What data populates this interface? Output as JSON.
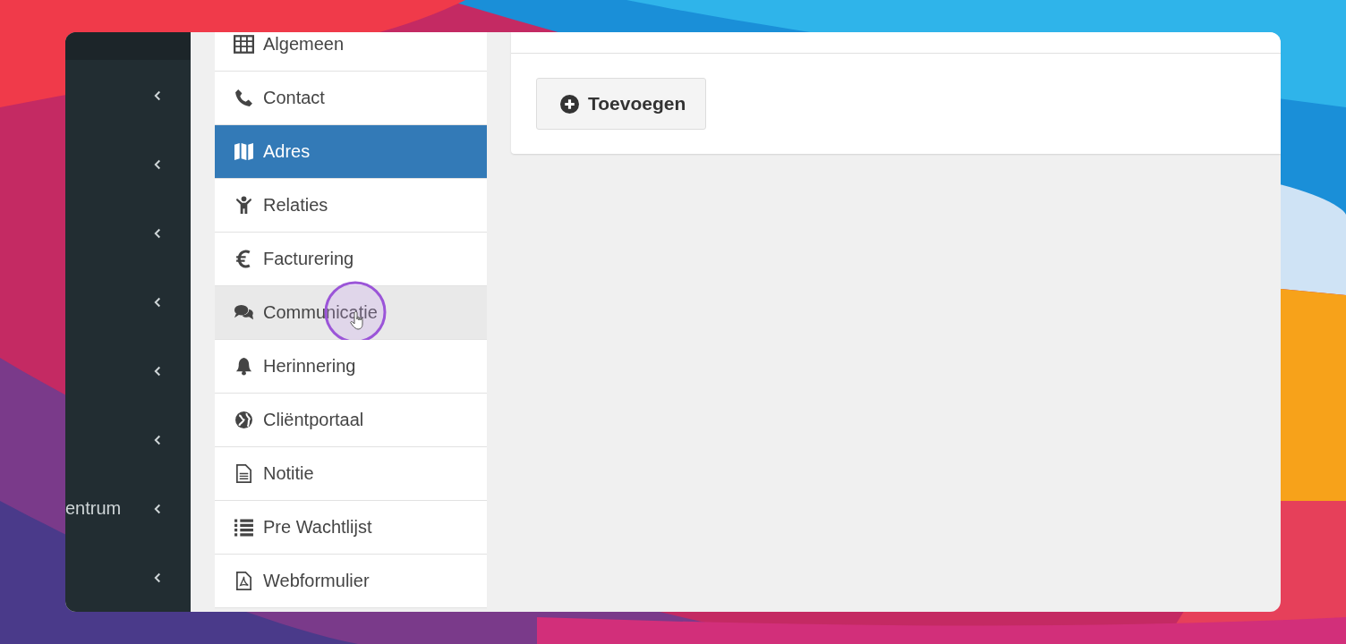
{
  "sidebar": {
    "items": [
      {
        "expanded": false
      },
      {
        "expanded": false
      },
      {
        "expanded": false
      },
      {
        "expanded": false
      },
      {
        "expanded": false
      },
      {
        "expanded": false
      },
      {
        "label": "entrum",
        "expanded": false
      },
      {
        "expanded": false
      }
    ]
  },
  "menu": {
    "items": [
      {
        "label": "Algemeen",
        "selected": false,
        "hovered": false,
        "pointer": false
      },
      {
        "label": "Contact",
        "selected": false,
        "hovered": false,
        "pointer": false
      },
      {
        "label": "Adres",
        "selected": true,
        "hovered": false,
        "pointer": false
      },
      {
        "label": "Relaties",
        "selected": false,
        "hovered": false,
        "pointer": false
      },
      {
        "label": "Facturering",
        "selected": false,
        "hovered": false,
        "pointer": false
      },
      {
        "label": "Communicatie",
        "selected": false,
        "hovered": true,
        "pointer": true
      },
      {
        "label": "Herinnering",
        "selected": false,
        "hovered": false,
        "pointer": false
      },
      {
        "label": "Cliëntportaal",
        "selected": false,
        "hovered": false,
        "pointer": false
      },
      {
        "label": "Notitie",
        "selected": false,
        "hovered": false,
        "pointer": false
      },
      {
        "label": "Pre Wachtlijst",
        "selected": false,
        "hovered": false,
        "pointer": false
      },
      {
        "label": "Webformulier",
        "selected": false,
        "hovered": false,
        "pointer": false
      }
    ]
  },
  "content": {
    "add_button": "Toevoegen"
  }
}
